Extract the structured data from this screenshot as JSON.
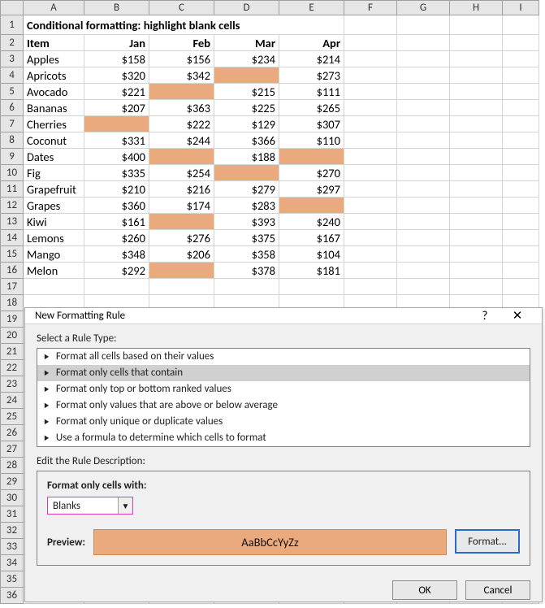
{
  "columns": [
    "A",
    "B",
    "C",
    "D",
    "E",
    "F",
    "G",
    "H",
    "I"
  ],
  "title": "Conditional formatting: highlight blank cells",
  "headers": {
    "item": "Item",
    "jan": "Jan",
    "feb": "Feb",
    "mar": "Mar",
    "apr": "Apr"
  },
  "rows": [
    {
      "item": "Apples",
      "jan": "$158",
      "feb": "$156",
      "mar": "$234",
      "apr": "$214"
    },
    {
      "item": "Apricots",
      "jan": "$320",
      "feb": "$342",
      "mar": "",
      "apr": "$273"
    },
    {
      "item": "Avocado",
      "jan": "$221",
      "feb": "",
      "mar": "$215",
      "apr": "$111"
    },
    {
      "item": "Bananas",
      "jan": "$207",
      "feb": "$363",
      "mar": "$225",
      "apr": "$265"
    },
    {
      "item": "Cherries",
      "jan": "",
      "feb": "$222",
      "mar": "$129",
      "apr": "$307"
    },
    {
      "item": "Coconut",
      "jan": "$331",
      "feb": "$244",
      "mar": "$366",
      "apr": "$110"
    },
    {
      "item": "Dates",
      "jan": "$400",
      "feb": "",
      "mar": "$188",
      "apr": ""
    },
    {
      "item": "Fig",
      "jan": "$335",
      "feb": "$254",
      "mar": "",
      "apr": "$270"
    },
    {
      "item": "Grapefruit",
      "jan": "$210",
      "feb": "$216",
      "mar": "$279",
      "apr": "$297"
    },
    {
      "item": "Grapes",
      "jan": "$360",
      "feb": "$174",
      "mar": "$283",
      "apr": ""
    },
    {
      "item": "Kiwi",
      "jan": "$161",
      "feb": "",
      "mar": "$393",
      "apr": "$240"
    },
    {
      "item": "Lemons",
      "jan": "$260",
      "feb": "$276",
      "mar": "$375",
      "apr": "$167"
    },
    {
      "item": "Mango",
      "jan": "$348",
      "feb": "$206",
      "mar": "$358",
      "apr": "$104"
    },
    {
      "item": "Melon",
      "jan": "$292",
      "feb": "",
      "mar": "$378",
      "apr": "$181"
    }
  ],
  "row_numbers": [
    "1",
    "2",
    "3",
    "4",
    "5",
    "6",
    "7",
    "8",
    "9",
    "10",
    "11",
    "12",
    "13",
    "14",
    "15",
    "16",
    "17",
    "18",
    "19",
    "20",
    "21",
    "22",
    "23",
    "24",
    "25",
    "26",
    "27",
    "28",
    "29",
    "30",
    "31",
    "32",
    "33",
    "34",
    "35",
    "36"
  ],
  "dialog": {
    "title": "New Formatting Rule",
    "help": "?",
    "close": "✕",
    "select_label": "Select a Rule Type:",
    "rule_types": [
      "Format all cells based on their values",
      "Format only cells that contain",
      "Format only top or bottom ranked values",
      "Format only values that are above or below average",
      "Format only unique or duplicate values",
      "Use a formula to determine which cells to format"
    ],
    "selected_index": 1,
    "edit_label": "Edit the Rule Description:",
    "format_only_label": "Format only cells with:",
    "combo_value": "Blanks",
    "preview_label": "Preview:",
    "preview_text": "AaBbCcYyZz",
    "format_button": "Format...",
    "ok": "OK",
    "cancel": "Cancel"
  },
  "chart_data": {
    "type": "table",
    "title": "Conditional formatting: highlight blank cells",
    "columns": [
      "Item",
      "Jan",
      "Feb",
      "Mar",
      "Apr"
    ],
    "rows": [
      [
        "Apples",
        158,
        156,
        234,
        214
      ],
      [
        "Apricots",
        320,
        342,
        null,
        273
      ],
      [
        "Avocado",
        221,
        null,
        215,
        111
      ],
      [
        "Bananas",
        207,
        363,
        225,
        265
      ],
      [
        "Cherries",
        null,
        222,
        129,
        307
      ],
      [
        "Coconut",
        331,
        244,
        366,
        110
      ],
      [
        "Dates",
        400,
        null,
        188,
        null
      ],
      [
        "Fig",
        335,
        254,
        null,
        270
      ],
      [
        "Grapefruit",
        210,
        216,
        279,
        297
      ],
      [
        "Grapes",
        360,
        174,
        283,
        null
      ],
      [
        "Kiwi",
        161,
        null,
        393,
        240
      ],
      [
        "Lemons",
        260,
        276,
        375,
        167
      ],
      [
        "Mango",
        348,
        206,
        358,
        104
      ],
      [
        "Melon",
        292,
        null,
        378,
        181
      ]
    ]
  }
}
